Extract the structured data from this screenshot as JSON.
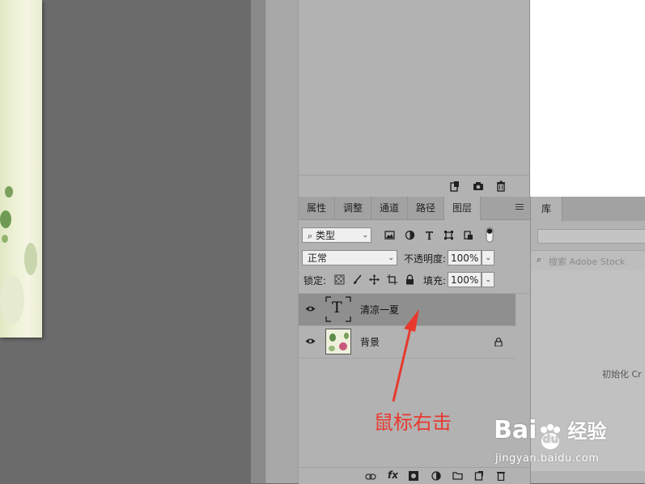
{
  "colors": {
    "canvas_bg": "#6b6b6b",
    "panel_bg": "#b2b2b2",
    "selected_row": "#8f8f8f",
    "annotation_red": "#e8392e",
    "watermark_white": "#ffffff"
  },
  "panel_tabs": [
    {
      "label": "属性"
    },
    {
      "label": "调整"
    },
    {
      "label": "通道"
    },
    {
      "label": "路径"
    },
    {
      "label": "图层",
      "active": true
    }
  ],
  "filter": {
    "kind_label": "类型",
    "icons": [
      "image-filter-icon",
      "adjustment-filter-icon",
      "type-filter-icon",
      "shape-filter-icon",
      "smartobject-filter-icon",
      "filter-toggle-icon"
    ]
  },
  "blend": {
    "mode": "正常",
    "opacity_label": "不透明度:",
    "opacity_value": "100%"
  },
  "lock": {
    "label": "锁定:",
    "fill_label": "填充:",
    "fill_value": "100%",
    "icons": [
      "lock-transparent-icon",
      "lock-paint-icon",
      "lock-move-icon",
      "lock-artboard-icon",
      "lock-all-icon"
    ]
  },
  "layers": [
    {
      "name": "清凉一夏",
      "type": "text",
      "thumb_glyph": "T",
      "selected": true
    },
    {
      "name": "背景",
      "type": "image",
      "locked": true
    }
  ],
  "history_toolbar_icons": [
    "new-document-from-state-icon",
    "snapshot-camera-icon",
    "trash-icon"
  ],
  "layers_bottom_icons": [
    "link-icon",
    "fx-icon",
    "mask-icon",
    "adjustment-layer-icon",
    "group-folder-icon",
    "new-layer-icon",
    "trash-icon"
  ],
  "layers_bottom_fx_label": "fx",
  "library": {
    "tab_label": "库",
    "search_placeholder": "搜索 Adobe Stock",
    "init_text": "初始化 Cr"
  },
  "annotation": {
    "text": "鼠标右击"
  },
  "watermark": {
    "brand_left": "Bai",
    "brand_paw": "du",
    "brand_right": "经验",
    "url": "jingyan.baidu.com"
  }
}
